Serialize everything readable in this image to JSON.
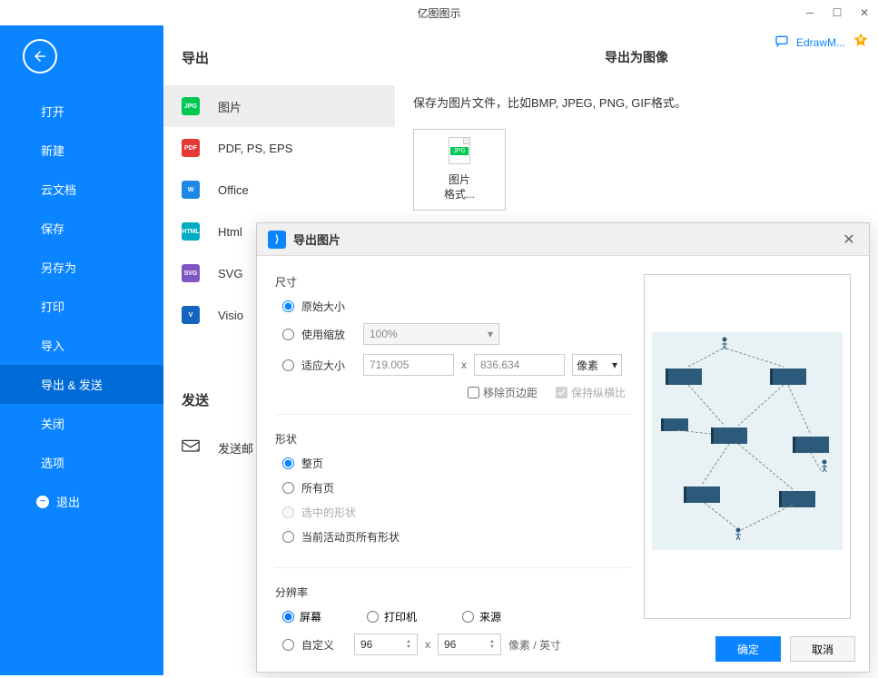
{
  "titlebar": {
    "title": "亿图图示"
  },
  "header": {
    "edrawLink": "EdrawM..."
  },
  "sidebar": {
    "items": [
      {
        "label": "打开"
      },
      {
        "label": "新建"
      },
      {
        "label": "云文档"
      },
      {
        "label": "保存"
      },
      {
        "label": "另存为"
      },
      {
        "label": "打印"
      },
      {
        "label": "导入"
      },
      {
        "label": "导出 & 发送"
      },
      {
        "label": "关闭"
      },
      {
        "label": "选项"
      }
    ],
    "exit": "退出"
  },
  "export": {
    "title": "导出",
    "items": [
      {
        "label": "图片",
        "badge": "JPG"
      },
      {
        "label": "PDF, PS, EPS",
        "badge": "PDF"
      },
      {
        "label": "Office",
        "badge": "W"
      },
      {
        "label": "Html",
        "badge": "HTML"
      },
      {
        "label": "SVG",
        "badge": "SVG"
      },
      {
        "label": "Visio",
        "badge": "V"
      }
    ],
    "sendTitle": "发送",
    "sendEmail": "发送邮"
  },
  "detail": {
    "title": "导出为图像",
    "desc": "保存为图片文件，比如BMP, JPEG, PNG, GIF格式。",
    "cardLabel": "图片\n格式..."
  },
  "dialog": {
    "title": "导出图片",
    "size": {
      "label": "尺寸",
      "original": "原始大小",
      "useZoom": "使用缩放",
      "zoomValue": "100%",
      "fitSize": "适应大小",
      "width": "719.005",
      "height": "836.634",
      "unit": "像素",
      "removeMargin": "移除页边距",
      "keepRatio": "保持纵横比"
    },
    "shape": {
      "label": "形状",
      "fullPage": "整页",
      "allPages": "所有页",
      "selected": "选中的形状",
      "activePage": "当前活动页所有形状"
    },
    "resolution": {
      "label": "分辨率",
      "screen": "屏幕",
      "printer": "打印机",
      "source": "来源",
      "custom": "自定义",
      "dpiX": "96",
      "dpiY": "96",
      "unit": "像素 / 英寸"
    },
    "ok": "确定",
    "cancel": "取消"
  }
}
